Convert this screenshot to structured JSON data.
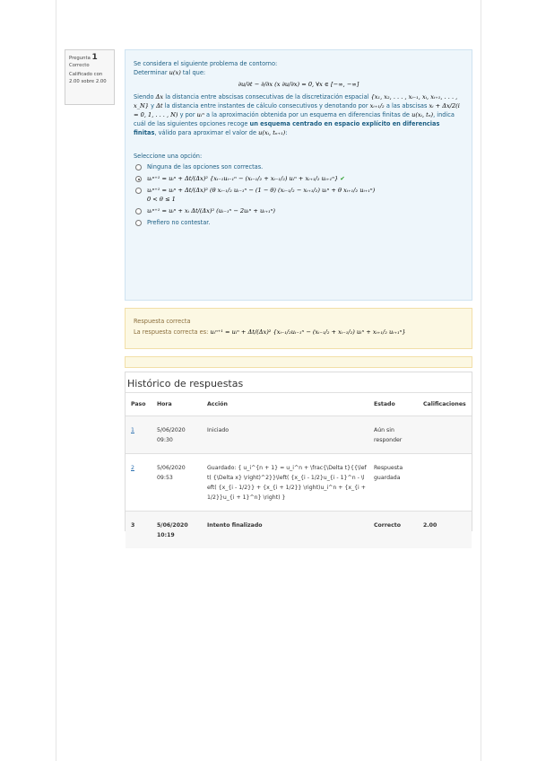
{
  "info": {
    "label": "Pregunta",
    "number": "1",
    "state": "Correcto",
    "grade": "Calificado con 2.00 sobre 2.00"
  },
  "question": {
    "intro": "Se considera el siguiente problema de contorno:",
    "determine": "Determinar",
    "determine_fn": "u(x)",
    "determine_tail": "tal que:",
    "equation": "∂u/∂t − ∂/∂x (x ∂u/∂x) = 0,   ∀x ∈ [−∞, −∞]",
    "s1": "Siendo",
    "dx": "Δx",
    "s2": "la distancia entre abscisas consecutivas de la discretización espacial",
    "set": "{x₁, x₂, . . . , xᵢ₋₁, xᵢ, xᵢ₊₁, . . . , x_N}",
    "s3": "y",
    "dt": "Δt",
    "s4": "la distancia entre instantes de cálculo consecutivos   y denotando por",
    "xh": "xᵢ₊₁/₂",
    "s5": "a las abscisas",
    "xhdef": "xᵢ + Δx/2(i = 0, 1, . . . , N)",
    "s6": "y por",
    "uin": "uᵢⁿ",
    "s7": "a la aproximación obtenida por un esquema en diferencias finitas de",
    "ufn": "u(xᵢ, tₙ)",
    "s8": ", indica cuál de las siguientes opciones recoge",
    "bold": "un esquema centrado en espacio explícito en diferencias finitas",
    "s9": ", válido para aproximar el valor de",
    "uval": "u(xᵢ, tₙ₊₁)",
    "s10": ":",
    "select": "Seleccione una opción:",
    "options": [
      {
        "text": "Ninguna de las opciones son correctas.",
        "math": false
      },
      {
        "text": "uᵢⁿ⁺¹ = uᵢⁿ + Δt/(Δx)² {xᵢ₋₁uᵢ₋₁ⁿ − (xᵢ₋₁/₂ + xᵢ₋₁/₂) uᵢⁿ + xᵢ₊₁/₂ uᵢ₊₁ⁿ}",
        "math": true
      },
      {
        "text": "uᵢⁿ⁺¹ = uᵢⁿ + Δt/(Δx)² (θ xᵢ₋₁/₂ uᵢ₋₁ⁿ − (1 − θ) (xᵢ₋₁/₂ − xᵢ₊₁/₂) uᵢⁿ + θ xᵢ₊₁/₂ uᵢ₊₁ⁿ)",
        "extra": "0 < θ ≤ 1",
        "math": true
      },
      {
        "text": "uᵢⁿ⁺¹ = uᵢⁿ + xᵢ Δt/(Δx)² (uᵢ₋₁ⁿ − 2uᵢⁿ + uᵢ₊₁ⁿ)",
        "math": true
      },
      {
        "text": "Prefiero no contestar.",
        "math": false
      }
    ],
    "selected_index": 1,
    "check": "✔"
  },
  "feedback": {
    "title": "Respuesta correcta",
    "lead": "La respuesta correcta es:",
    "answer": "uᵢⁿ⁺¹ = uᵢⁿ + Δt/(Δx)² {xᵢ₋₁/₂uᵢ₋₁ⁿ − (xᵢ₋₁/₂ + xᵢ₋₁/₂) uᵢⁿ + xᵢ₊₁/₂ uᵢ₊₁ⁿ}"
  },
  "history": {
    "title": "Histórico de respuestas",
    "headers": [
      "Paso",
      "Hora",
      "Acción",
      "Estado",
      "Calificaciones"
    ],
    "rows": [
      {
        "step": "1",
        "time": "5/06/2020 09:30",
        "action": "Iniciado",
        "state": "Aún sin responder",
        "grade": ""
      },
      {
        "step": "2",
        "time": "5/06/2020 09:53",
        "action": "Guardado: { u_i^{n + 1} = u_i^n + \\frac{\\Delta t}{{\\left( {\\Delta x} \\right)^2}}\\left( {x_{i - 1/2}u_{i - 1}^n - \\left( {x_{i - 1/2}} + {x_{i + 1/2}} \\right)u_i^n + {x_{i + 1/2}}u_{i + 1}^n} \\right) }",
        "state": "Respuesta guardada",
        "grade": ""
      },
      {
        "step": "3",
        "time": "5/06/2020 10:19",
        "action": "Intento finalizado",
        "state": "Correcto",
        "grade": "2.00"
      }
    ]
  }
}
